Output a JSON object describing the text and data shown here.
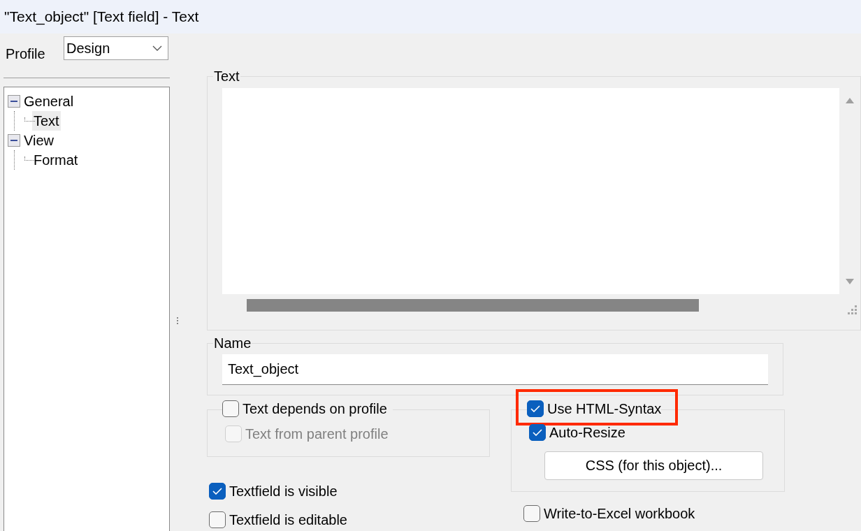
{
  "window": {
    "title": "\"Text_object\" [Text field] - Text"
  },
  "profile": {
    "label": "Profile",
    "value": "Design"
  },
  "tree": [
    {
      "label": "General",
      "expanded": true,
      "selected": false,
      "children": [
        {
          "label": "Text",
          "selected": true
        }
      ]
    },
    {
      "label": "View",
      "expanded": true,
      "selected": false,
      "children": [
        {
          "label": "Format",
          "selected": false
        }
      ]
    }
  ],
  "text_group": {
    "label": "Text"
  },
  "name_group": {
    "label": "Name",
    "value": "Text_object"
  },
  "profile_group": {
    "header": {
      "label": "Text depends on profile",
      "checked": false,
      "disabled": false
    },
    "options": [
      {
        "label": "Text from parent profile",
        "checked": false,
        "disabled": true
      }
    ]
  },
  "html_group": {
    "header": {
      "label": "Use HTML-Syntax",
      "checked": true,
      "disabled": false,
      "highlighted": true
    },
    "options": [
      {
        "label": "Auto-Resize",
        "checked": true,
        "disabled": false
      }
    ],
    "button": "CSS (for this object)..."
  },
  "left_options": [
    {
      "label": "Textfield is visible",
      "checked": true,
      "disabled": false
    },
    {
      "label": "Textfield is editable",
      "checked": false,
      "disabled": false
    }
  ],
  "right_options": [
    {
      "label": "Write-to-Excel workbook",
      "checked": false,
      "disabled": false
    }
  ]
}
